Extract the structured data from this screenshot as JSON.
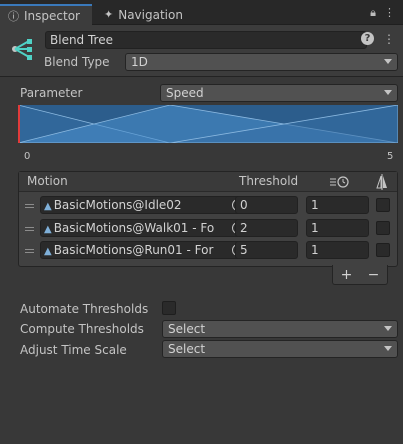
{
  "tabs": [
    {
      "label": "Inspector",
      "icon": "info-icon"
    },
    {
      "label": "Navigation",
      "icon": "navigation-icon"
    }
  ],
  "header": {
    "name_value": "Blend Tree",
    "blend_type_label": "Blend Type",
    "blend_type_value": "1D"
  },
  "parameter": {
    "label": "Parameter",
    "value": "Speed"
  },
  "graph": {
    "min_label": "0",
    "max_label": "5",
    "thresholds": [
      0,
      2,
      5
    ],
    "range": [
      0,
      5
    ]
  },
  "table": {
    "headers": {
      "motion": "Motion",
      "threshold": "Threshold"
    },
    "rows": [
      {
        "motion": "BasicMotions@Idle02",
        "threshold": "0",
        "speed": "1"
      },
      {
        "motion": "BasicMotions@Walk01 - Fo",
        "threshold": "2",
        "speed": "1"
      },
      {
        "motion": "BasicMotions@Run01 - For",
        "threshold": "5",
        "speed": "1"
      }
    ]
  },
  "buttons": {
    "add": "+",
    "remove": "−"
  },
  "settings": {
    "automate_label": "Automate Thresholds",
    "compute_label": "Compute Thresholds",
    "compute_value": "Select",
    "adjust_label": "Adjust Time Scale",
    "adjust_value": "Select"
  },
  "colors": {
    "accent": "#3a79bb",
    "graph_fill": "#2c5d8c",
    "graph_highlight": "#4a8fce",
    "marker_red": "#e23b3b"
  }
}
